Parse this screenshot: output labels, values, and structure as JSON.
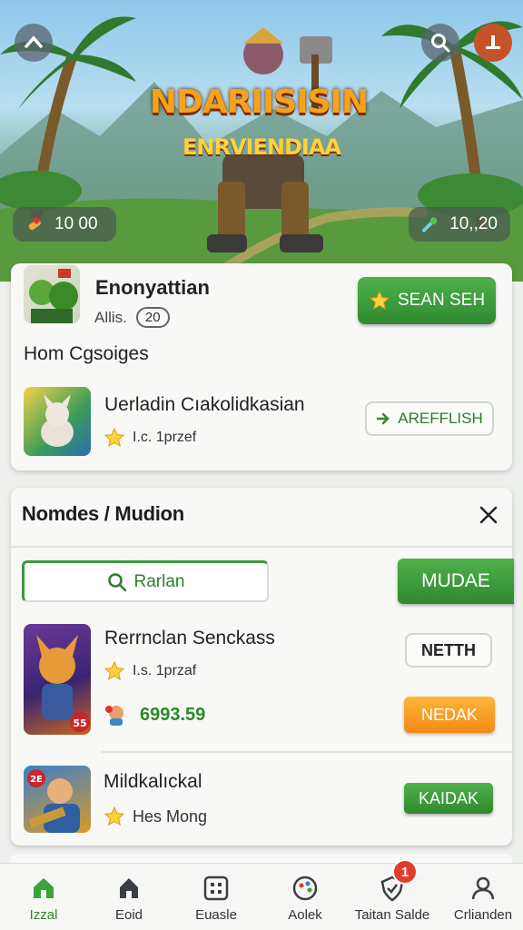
{
  "hero": {
    "title": "NDARIISISIN",
    "subtitle": "ENRVIENDIAA",
    "coins": "10 00",
    "gems": "10,,20"
  },
  "featured": {
    "name": "Enonyattian",
    "sub_label": "Allis.",
    "level": "20",
    "search_button": "SEAN SEH"
  },
  "section_heading": "Hom Cgsoiges",
  "item1": {
    "name": "Uerladin Cıakolidkasian",
    "meta": "I.c. 1przef",
    "button": "AREFFLISH"
  },
  "panel": {
    "title": "Nomdes / Mudion",
    "search_placeholder": "Rarlan",
    "action_button": "MUDAE",
    "item_a": {
      "name": "Rerrnclan Senckass",
      "meta": "I.s. 1przaf",
      "price": "6993.59",
      "badge": "55",
      "button_top": "NETTH",
      "button_bottom": "NEDAK"
    },
    "item_b": {
      "name": "Mildkalıckal",
      "meta": "Hes Mong",
      "badge": "2E",
      "button": "KAIDAK"
    }
  },
  "nav": {
    "items": [
      {
        "label": "Izzal",
        "icon": "home-icon"
      },
      {
        "label": "Eoid",
        "icon": "arrow-house-icon"
      },
      {
        "label": "Euasle",
        "icon": "grid-icon"
      },
      {
        "label": "Aolek",
        "icon": "palette-icon"
      },
      {
        "label": "Taitan Salde",
        "icon": "shield-icon"
      },
      {
        "label": "Crlianden",
        "icon": "person-icon"
      }
    ],
    "notification_count": "1"
  },
  "colors": {
    "accent_green": "#2f8a2f",
    "orange": "#f28a14",
    "notification_red": "#e23b2a"
  }
}
